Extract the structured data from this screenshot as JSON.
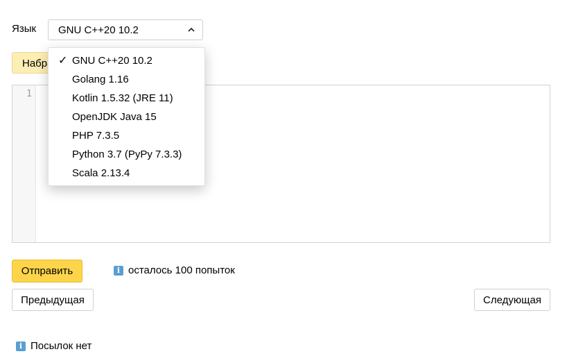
{
  "language": {
    "label": "Язык",
    "selected": "GNU C++20 10.2",
    "options": [
      "GNU C++20 10.2",
      "Golang 1.16",
      "Kotlin 1.5.32 (JRE 11)",
      "OpenJDK Java 15",
      "PHP 7.3.5",
      "Python 3.7 (PyPy 7.3.3)",
      "Scala 2.13.4"
    ],
    "checkmark": "✓"
  },
  "type_button_label": "Набрать",
  "editor": {
    "line_numbers": [
      "1"
    ]
  },
  "submit_label": "Отправить",
  "attempts_text": "осталось 100 попыток",
  "info_glyph": "i",
  "nav": {
    "prev_label": "Предыдущая",
    "next_label": "Следующая"
  },
  "no_submissions_text": "Посылок нет",
  "colors": {
    "submit_bg": "#fed54a",
    "type_button_bg": "#fdeeb4",
    "info_icon": "#5b9ed1"
  }
}
